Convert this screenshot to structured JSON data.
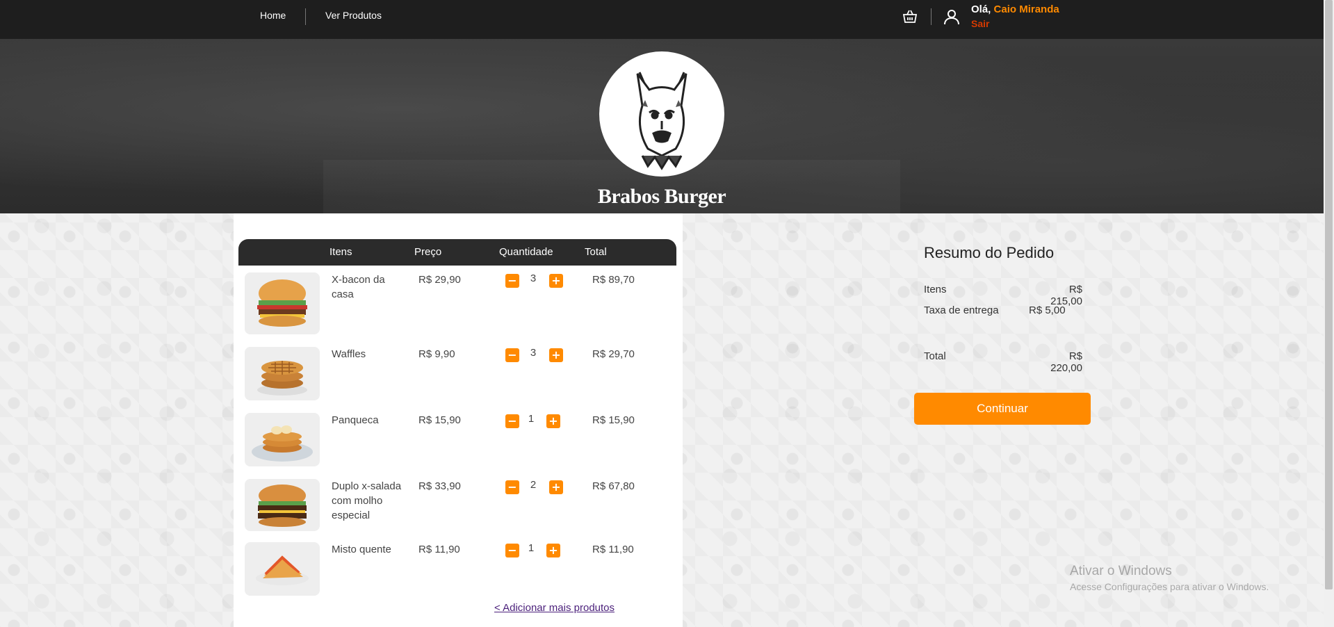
{
  "nav": {
    "home": "Home",
    "products": "Ver Produtos",
    "greeting": "Olá,",
    "user_name": "Caio Miranda",
    "logout": "Sair",
    "cart_icon": "basket-icon",
    "user_icon": "user-icon"
  },
  "hero": {
    "brand": "Brabos Burger",
    "logo": "pitbull-logo"
  },
  "cart": {
    "headers": {
      "items": "Itens",
      "price": "Preço",
      "qty": "Quantidade",
      "total": "Total"
    },
    "rows": [
      {
        "name_lines": [
          "X-bacon da",
          "casa"
        ],
        "price": "R$ 29,90",
        "qty": "3",
        "total": "R$ 89,70",
        "image": "burger"
      },
      {
        "name_lines": [
          "Waffles"
        ],
        "price": "R$ 9,90",
        "qty": "3",
        "total": "R$ 29,70",
        "image": "waffles"
      },
      {
        "name_lines": [
          "Panqueca"
        ],
        "price": "R$ 15,90",
        "qty": "1",
        "total": "R$ 15,90",
        "image": "pancakes"
      },
      {
        "name_lines": [
          "Duplo x-salada",
          "com molho",
          "especial"
        ],
        "price": "R$ 33,90",
        "qty": "2",
        "total": "R$ 67,80",
        "image": "double-burger"
      },
      {
        "name_lines": [
          "Misto quente"
        ],
        "price": "R$ 11,90",
        "qty": "1",
        "total": "R$ 11,90",
        "image": "sandwich"
      }
    ],
    "minus": "−",
    "plus": "+",
    "add_more": "< Adicionar mais produtos"
  },
  "summary": {
    "title": "Resumo do Pedido",
    "items_label": "Itens",
    "items_value": "R$ 215,00",
    "fee_label": "Taxa de entrega",
    "fee_value": "R$ 5,00",
    "total_label": "Total",
    "total_value": "R$ 220,00",
    "continue": "Continuar"
  },
  "watermark": {
    "line1": "Ativar o Windows",
    "line2": "Acesse Configurações para ativar o Windows."
  },
  "colors": {
    "accent": "#ff8a00",
    "nav_bg": "#1e1e1e",
    "logout": "#d63a00",
    "link": "#4a1f7a"
  }
}
